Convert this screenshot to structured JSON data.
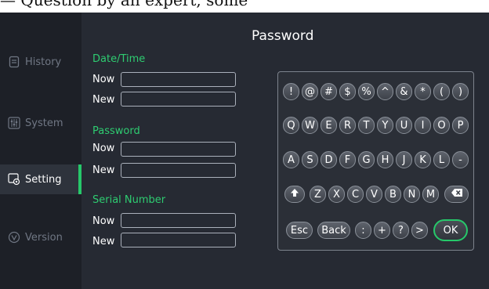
{
  "caption": "— Question by an expert, some",
  "title": "Password",
  "sidebar": {
    "items": [
      {
        "label": "History"
      },
      {
        "label": "System"
      },
      {
        "label": "Setting"
      },
      {
        "label": "Version"
      }
    ],
    "active": "Setting"
  },
  "sections": {
    "datetime": {
      "label": "Date/Time",
      "now": "Now",
      "new": "New"
    },
    "password": {
      "label": "Password",
      "now": "Now",
      "new": "New"
    },
    "serial": {
      "label": "Serial Number",
      "now": "Now",
      "new": "New"
    }
  },
  "keyboard": {
    "row1": [
      "!",
      "@",
      "#",
      "$",
      "%",
      "^",
      "&",
      "*",
      "(",
      ")"
    ],
    "row2": [
      "Q",
      "W",
      "E",
      "R",
      "T",
      "Y",
      "U",
      "I",
      "O",
      "P"
    ],
    "row3": [
      "A",
      "S",
      "D",
      "F",
      "G",
      "H",
      "J",
      "K",
      "L",
      "-"
    ],
    "row4": [
      "shift",
      "Z",
      "X",
      "C",
      "V",
      "B",
      "N",
      "M",
      "backspace"
    ],
    "row5": [
      "Esc",
      "Back",
      ":",
      "+",
      "?",
      ">",
      "OK"
    ]
  },
  "colors": {
    "accent": "#26c86a",
    "section": "#2ecc71"
  }
}
